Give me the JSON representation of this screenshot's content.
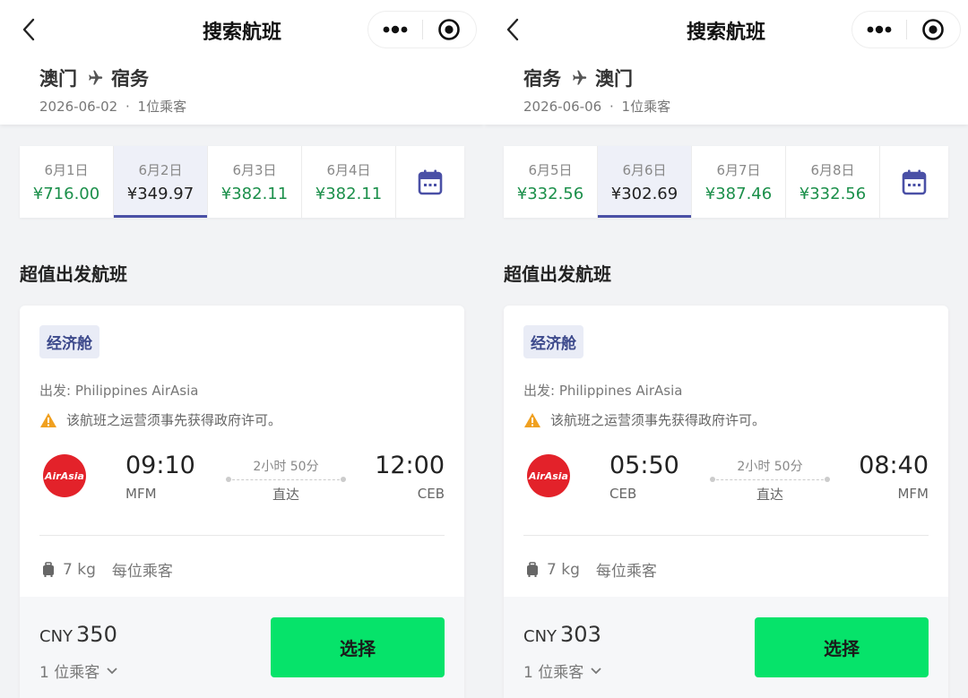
{
  "panels": [
    {
      "nav_title": "搜索航班",
      "from": "澳门",
      "to": "宿务",
      "date": "2026-06-02",
      "sep": "·",
      "passengers_info": "1位乘客",
      "dates": [
        {
          "label": "6月1日",
          "price": "¥716.00",
          "selected": false
        },
        {
          "label": "6月2日",
          "price": "¥349.97",
          "selected": true
        },
        {
          "label": "6月3日",
          "price": "¥382.11",
          "selected": false
        },
        {
          "label": "6月4日",
          "price": "¥382.11",
          "selected": false
        }
      ],
      "section_title": "超值出发航班",
      "flight": {
        "cabin": "经济舱",
        "carrier": "出发: Philippines AirAsia",
        "warning": "该航班之运营须事先获得政府许可。",
        "logo_text": "AirAsia",
        "dep_time": "09:10",
        "dep_code": "MFM",
        "arr_time": "12:00",
        "arr_code": "CEB",
        "duration": "2小时 50分",
        "stops": "直达",
        "baggage_weight": "7 kg",
        "baggage_note": "每位乘客",
        "currency": "CNY",
        "price": "350",
        "pax_label": "1 位乘客",
        "select_label": "选择"
      }
    },
    {
      "nav_title": "搜索航班",
      "from": "宿务",
      "to": "澳门",
      "date": "2026-06-06",
      "sep": "·",
      "passengers_info": "1位乘客",
      "dates": [
        {
          "label": "6月5日",
          "price": "¥332.56",
          "selected": false
        },
        {
          "label": "6月6日",
          "price": "¥302.69",
          "selected": true
        },
        {
          "label": "6月7日",
          "price": "¥387.46",
          "selected": false
        },
        {
          "label": "6月8日",
          "price": "¥332.56",
          "selected": false
        }
      ],
      "section_title": "超值出发航班",
      "flight": {
        "cabin": "经济舱",
        "carrier": "出发: Philippines AirAsia",
        "warning": "该航班之运营须事先获得政府许可。",
        "logo_text": "AirAsia",
        "dep_time": "05:50",
        "dep_code": "CEB",
        "arr_time": "08:40",
        "arr_code": "MFM",
        "duration": "2小时 50分",
        "stops": "直达",
        "baggage_weight": "7 kg",
        "baggage_note": "每位乘客",
        "currency": "CNY",
        "price": "303",
        "pax_label": "1 位乘客",
        "select_label": "选择"
      }
    }
  ],
  "icons": {
    "back": "chevron-left-icon",
    "more": "more-dots-icon",
    "target": "record-target-icon",
    "plane": "plane-icon",
    "calendar": "calendar-icon",
    "warning": "warning-triangle-icon",
    "luggage": "luggage-icon",
    "dropdown": "chevron-down-icon"
  },
  "colors": {
    "price_green": "#1b8f4a",
    "selected_underline": "#4a50a6",
    "select_button": "#06e36a",
    "airasia_red": "#e3222a",
    "warning_orange": "#f0a020"
  }
}
